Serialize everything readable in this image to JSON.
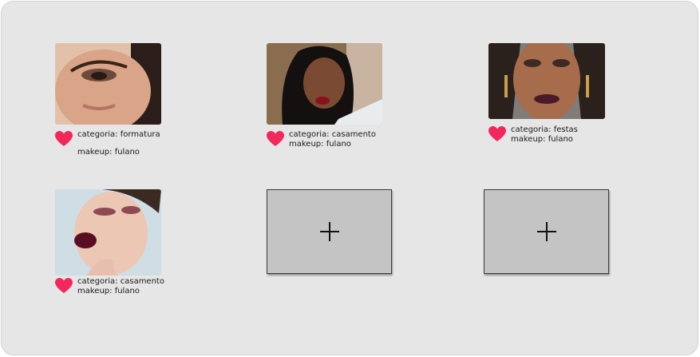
{
  "colors": {
    "panel_background": "#e6e6e6",
    "heart": "#f2275c",
    "add_tile": "#c4c4c4"
  },
  "cards": [
    {
      "category": "categoria: formatura",
      "makeup": "makeup: fulano",
      "icon": "heart-icon",
      "liked": true
    },
    {
      "category": "categoria: casamento",
      "makeup": "makeup: fulano",
      "icon": "heart-icon",
      "liked": true
    },
    {
      "category": "categoria: festas",
      "makeup": "makeup: fulano",
      "icon": "heart-icon",
      "liked": true
    },
    {
      "category": "categoria: casamento",
      "makeup": "makeup: fulano",
      "icon": "heart-icon",
      "liked": true
    }
  ],
  "add_tiles": [
    {
      "icon": "plus-icon"
    },
    {
      "icon": "plus-icon"
    }
  ]
}
